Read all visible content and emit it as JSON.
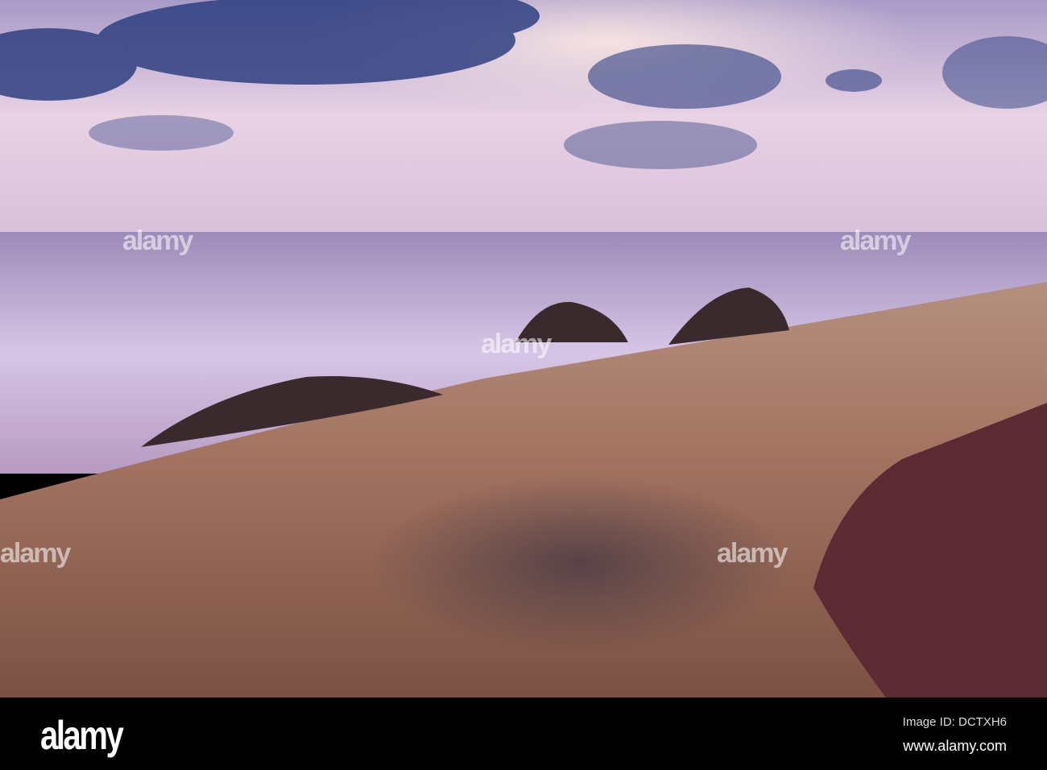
{
  "watermark": {
    "text": "alamy"
  },
  "footer": {
    "logo": "alamy",
    "image_id": "Image ID: DCTXH6",
    "website": "www.alamy.com"
  },
  "colors": {
    "sky": "#d9c3dc",
    "clouds": "#2c3d7a",
    "sand": "#8a6050",
    "rock": "#5a2a30"
  }
}
